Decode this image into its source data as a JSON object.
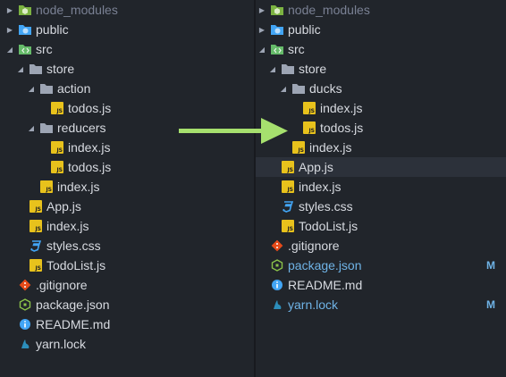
{
  "comparison": [
    {
      "panel": "before",
      "items": [
        {
          "label": "node_modules",
          "icon": "folder-node-icon",
          "caret": "collapsed",
          "status": "ignored"
        },
        {
          "label": "public",
          "icon": "folder-web-icon",
          "caret": "collapsed"
        },
        {
          "label": "src",
          "icon": "folder-src-icon",
          "caret": "expanded"
        },
        {
          "label": "store",
          "icon": "folder-icon",
          "caret": "expanded"
        },
        {
          "label": "action",
          "icon": "folder-icon",
          "caret": "expanded"
        },
        {
          "label": "todos.js",
          "icon": "js-file-icon"
        },
        {
          "label": "reducers",
          "icon": "folder-icon",
          "caret": "expanded"
        },
        {
          "label": "index.js",
          "icon": "js-file-icon"
        },
        {
          "label": "todos.js",
          "icon": "js-file-icon"
        },
        {
          "label": "index.js",
          "icon": "js-file-icon"
        },
        {
          "label": "App.js",
          "icon": "js-file-icon"
        },
        {
          "label": "index.js",
          "icon": "js-file-icon"
        },
        {
          "label": "styles.css",
          "icon": "css-file-icon"
        },
        {
          "label": "TodoList.js",
          "icon": "js-file-icon"
        },
        {
          "label": ".gitignore",
          "icon": "git-icon"
        },
        {
          "label": "package.json",
          "icon": "node-package-icon"
        },
        {
          "label": "README.md",
          "icon": "info-icon"
        },
        {
          "label": "yarn.lock",
          "icon": "yarn-icon"
        }
      ]
    },
    {
      "panel": "after",
      "items": [
        {
          "label": "node_modules",
          "icon": "folder-node-icon",
          "caret": "collapsed",
          "status": "ignored"
        },
        {
          "label": "public",
          "icon": "folder-web-icon",
          "caret": "collapsed"
        },
        {
          "label": "src",
          "icon": "folder-src-icon",
          "caret": "expanded"
        },
        {
          "label": "store",
          "icon": "folder-icon",
          "caret": "expanded"
        },
        {
          "label": "ducks",
          "icon": "folder-icon",
          "caret": "expanded"
        },
        {
          "label": "index.js",
          "icon": "js-file-icon"
        },
        {
          "label": "todos.js",
          "icon": "js-file-icon"
        },
        {
          "label": "index.js",
          "icon": "js-file-icon"
        },
        {
          "label": "App.js",
          "icon": "js-file-icon",
          "selected": true
        },
        {
          "label": "index.js",
          "icon": "js-file-icon"
        },
        {
          "label": "styles.css",
          "icon": "css-file-icon"
        },
        {
          "label": "TodoList.js",
          "icon": "js-file-icon"
        },
        {
          "label": ".gitignore",
          "icon": "git-icon"
        },
        {
          "label": "package.json",
          "icon": "node-package-icon",
          "status": "modified",
          "badge": "M"
        },
        {
          "label": "README.md",
          "icon": "info-icon"
        },
        {
          "label": "yarn.lock",
          "icon": "yarn-icon",
          "status": "modified",
          "badge": "M"
        }
      ]
    }
  ],
  "colors": {
    "background": "#21252b",
    "text": "#d7dae0",
    "ignored_text": "#7a8194",
    "modified_text": "#6fb3e6",
    "selected_row": "#2c313a",
    "arrow": "#a6e06e",
    "js_icon": "#e8c21c",
    "css_icon": "#42a5f5",
    "git_icon": "#e64a19",
    "info_icon": "#42a5f5"
  }
}
